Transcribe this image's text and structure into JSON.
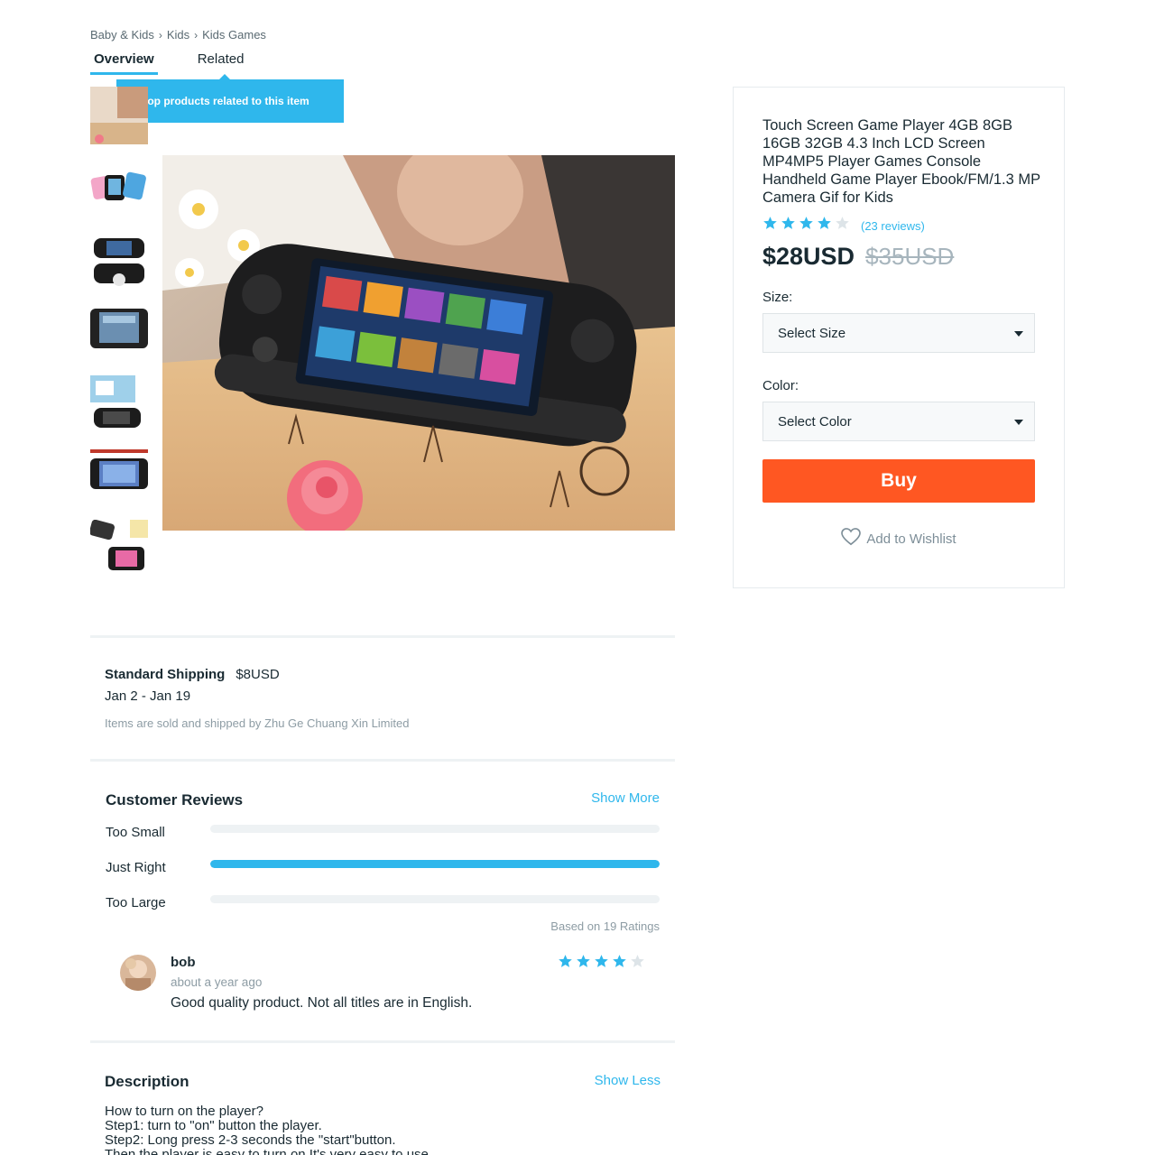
{
  "breadcrumb": {
    "items": [
      "Baby & Kids",
      "Kids",
      "Kids Games"
    ]
  },
  "tabs": {
    "overview": "Overview",
    "related": "Related"
  },
  "tooltip": {
    "text": "Shop products related to this item"
  },
  "product": {
    "title": "Touch Screen Game Player 4GB 8GB 16GB 32GB 4.3 Inch LCD Screen MP4MP5 Player Games Console Handheld Game Player Ebook/FM/1.3 MP Camera Gif for Kids",
    "rating": 4,
    "rating_max": 5,
    "reviews_text": "(23 reviews)",
    "price": "$28USD",
    "price_old": "$35USD",
    "size_label": "Size:",
    "size_select": "Select Size",
    "color_label": "Color:",
    "color_select": "Select Color",
    "buy_label": "Buy",
    "wishlist_label": "Add to Wishlist"
  },
  "shipping": {
    "title": "Standard Shipping",
    "price": "$8USD",
    "dates": "Jan 2 - Jan 19",
    "note": "Items are sold and shipped by Zhu Ge Chuang Xin Limited"
  },
  "reviews": {
    "heading": "Customer Reviews",
    "show_more": "Show More",
    "fit": [
      {
        "label": "Too Small",
        "fraction": 0.0
      },
      {
        "label": "Just Right",
        "fraction": 1.0
      },
      {
        "label": "Too Large",
        "fraction": 0.0
      }
    ],
    "based_on": "Based on 19 Ratings",
    "items": [
      {
        "name": "bob",
        "time": "about a year ago",
        "text": "Good quality product. Not all titles are in English.",
        "rating": 4
      }
    ]
  },
  "description": {
    "heading": "Description",
    "show_less": "Show Less",
    "lines": [
      "How to turn on the player?",
      "Step1: turn to \"on\" button the player.",
      "Step2: Long press 2-3 seconds the \"start\"button.",
      "Then the player is easy to turn on It's very easy to use."
    ]
  },
  "colors": {
    "accent": "#2fb7ec",
    "buy": "#ff5722",
    "text": "#192a32",
    "muted": "#8d9ca4"
  }
}
